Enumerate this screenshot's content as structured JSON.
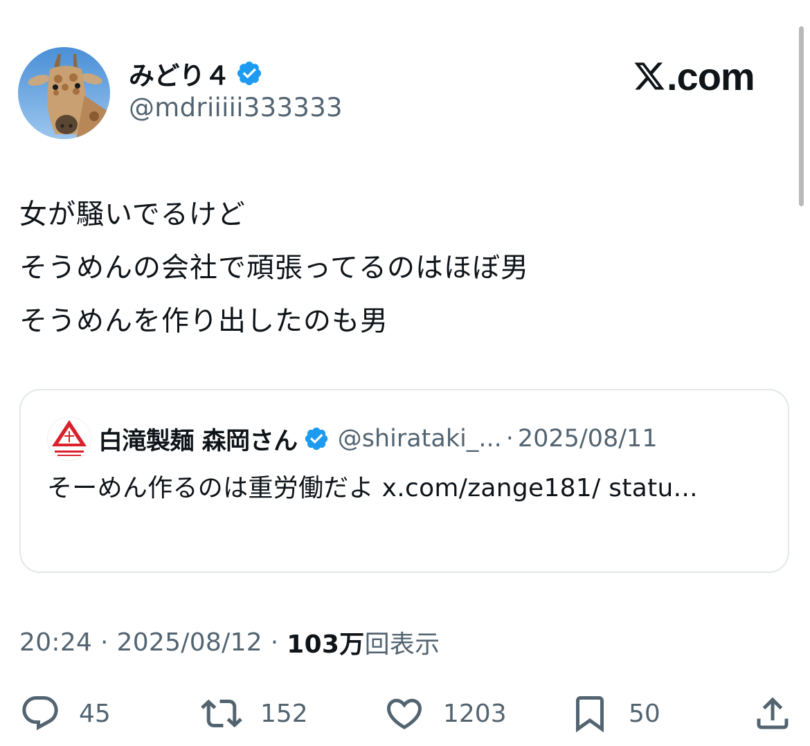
{
  "author": {
    "display_name": "みどり４",
    "handle": "@mdriiiii333333",
    "avatar_icon": "giraffe-avatar"
  },
  "brand": {
    "label": ".com",
    "logo_icon": "x-logo-icon"
  },
  "tweet": {
    "lines": [
      "女が騒いでるけど",
      "そうめんの会社で頑張ってるのはほぼ男",
      "そうめんを作り出したのも男"
    ]
  },
  "quote": {
    "name": "白滝製麺 森岡さん",
    "handle": "@shirataki_...",
    "separator": "·",
    "date": "2025/08/11",
    "text": "そーめん作るのは重労働だよ x.com/zange181/ statu..."
  },
  "meta": {
    "time": "20:24",
    "sep1": " · ",
    "date": "2025/08/12",
    "sep2": " · ",
    "views_count": "103万",
    "views_label": "回表示"
  },
  "actions": {
    "replies": "45",
    "reposts": "152",
    "likes": "1203",
    "bookmarks": "50"
  },
  "colors": {
    "verified": "#1d9bf0",
    "muted_text": "#536471",
    "primary_text": "#0f1419",
    "quote_logo_red": "#d9212c"
  }
}
